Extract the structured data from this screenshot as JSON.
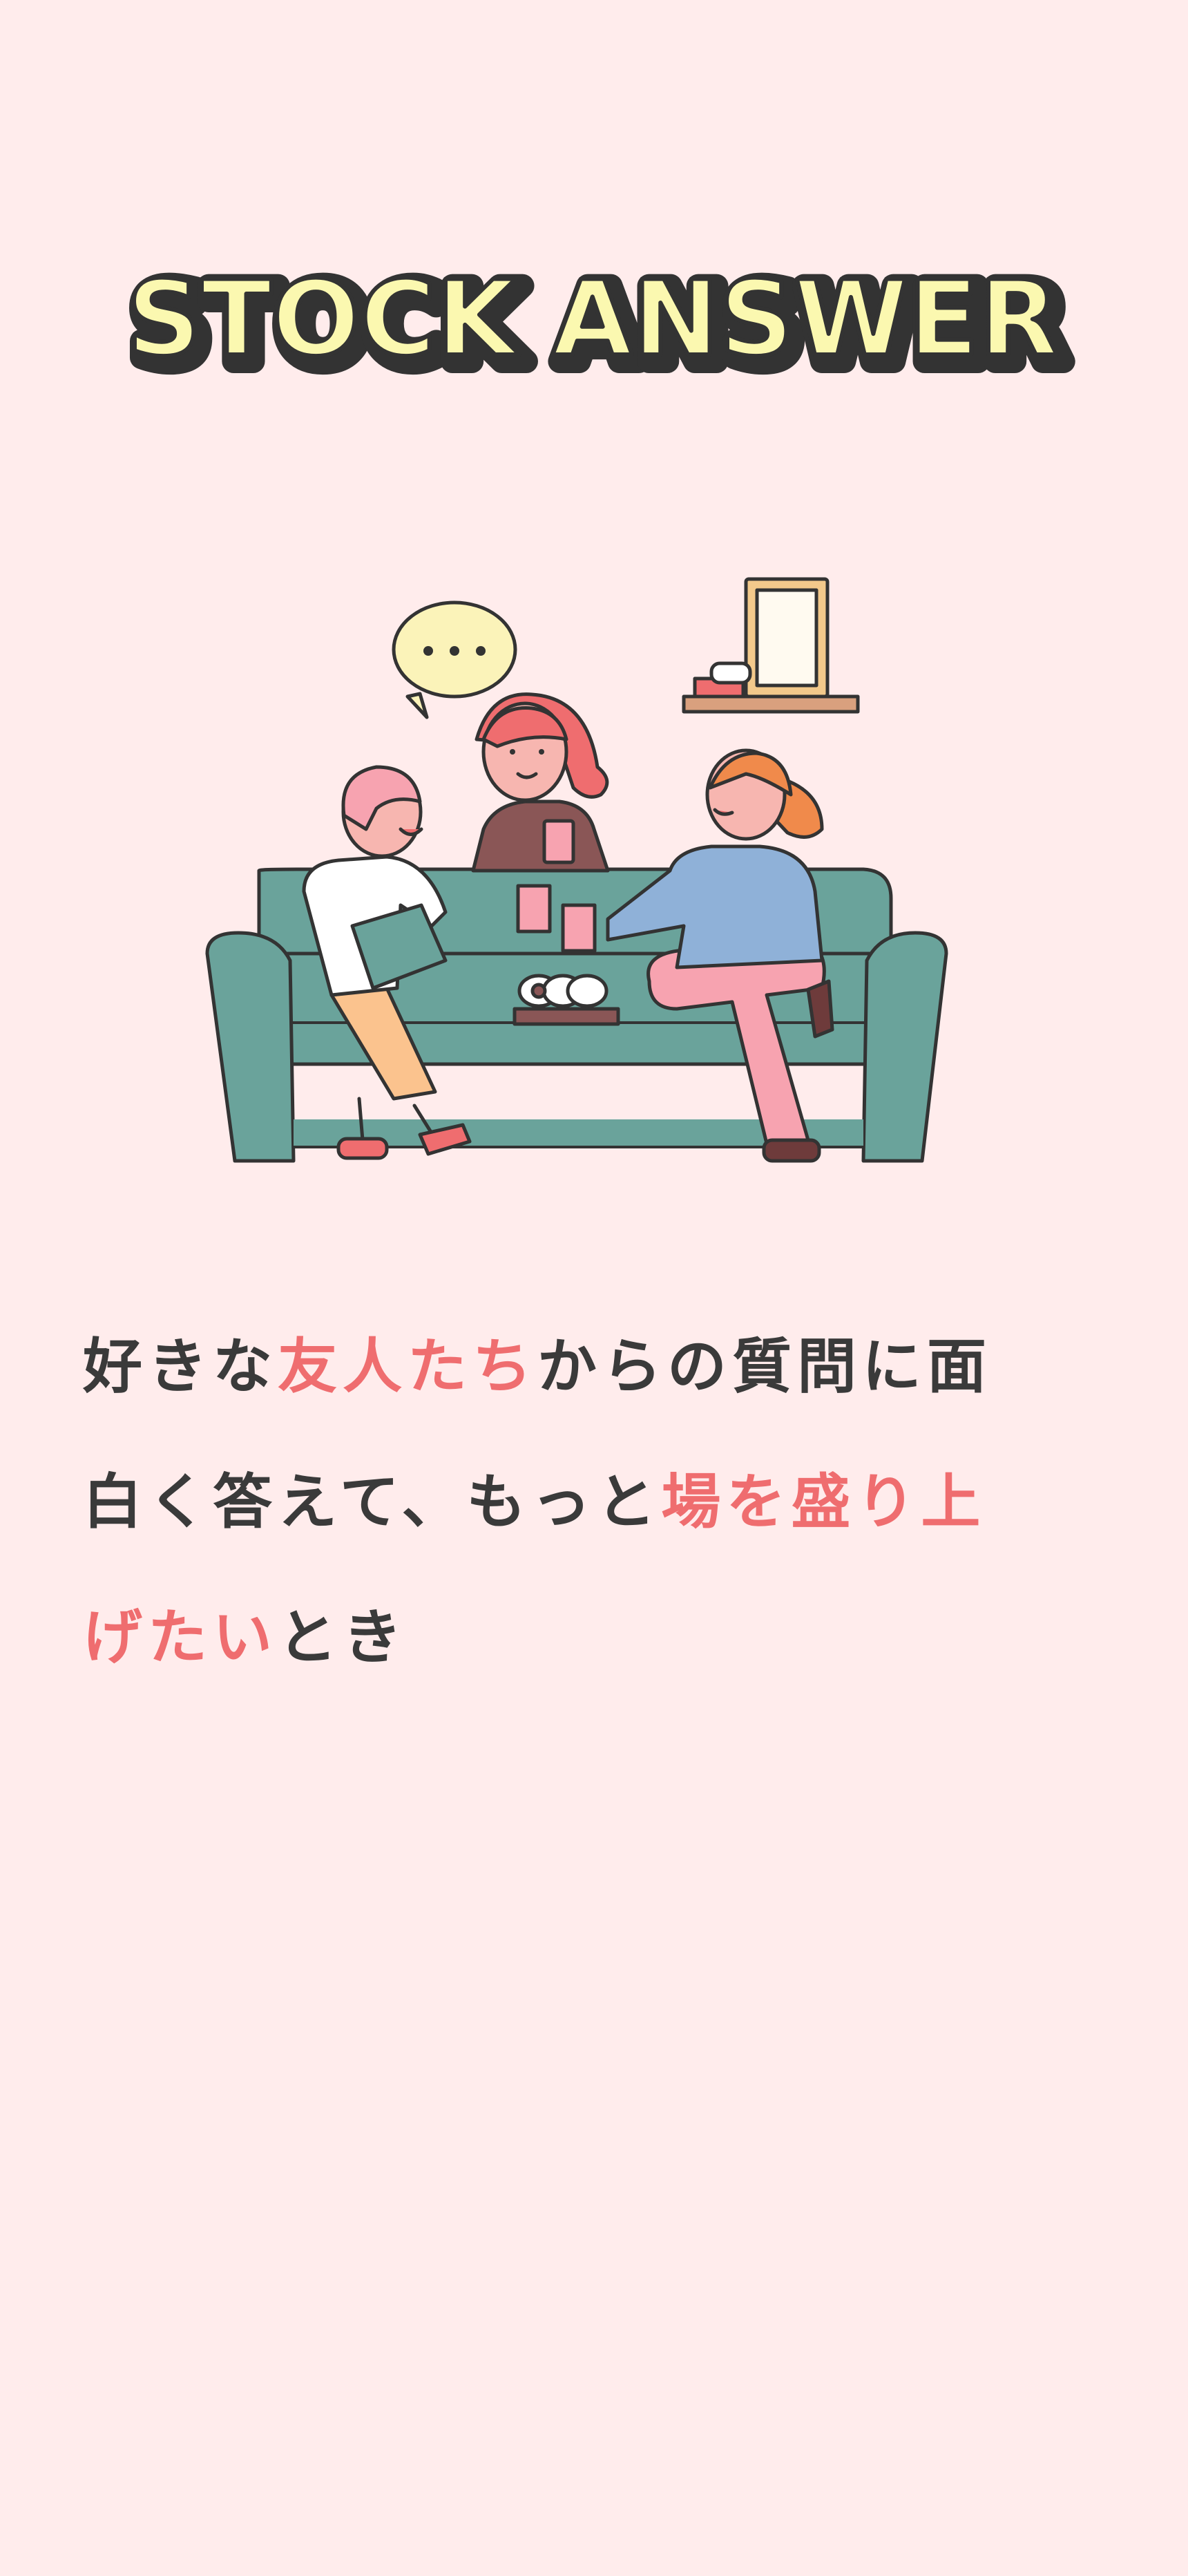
{
  "app": {
    "title": "STOCK ANSWER"
  },
  "hero": {
    "speech_bubble_text": "..."
  },
  "copy": {
    "segments": [
      {
        "text": "好きな",
        "highlight": false
      },
      {
        "text": "友人たち",
        "highlight": true
      },
      {
        "text": "からの質問に面",
        "highlight": false
      },
      {
        "text": "白く答えて、もっと",
        "highlight": false
      },
      {
        "text": "場を盛り上",
        "highlight": true
      },
      {
        "text": "げたい",
        "highlight": true
      },
      {
        "text": "とき",
        "highlight": false
      }
    ]
  },
  "colors": {
    "background": "#ffecec",
    "logo_fill": "#fbf8b0",
    "logo_outline": "#333333",
    "text_primary": "#3a3a3a",
    "text_highlight": "#ef6d6f",
    "sofa": "#6aa39b"
  }
}
